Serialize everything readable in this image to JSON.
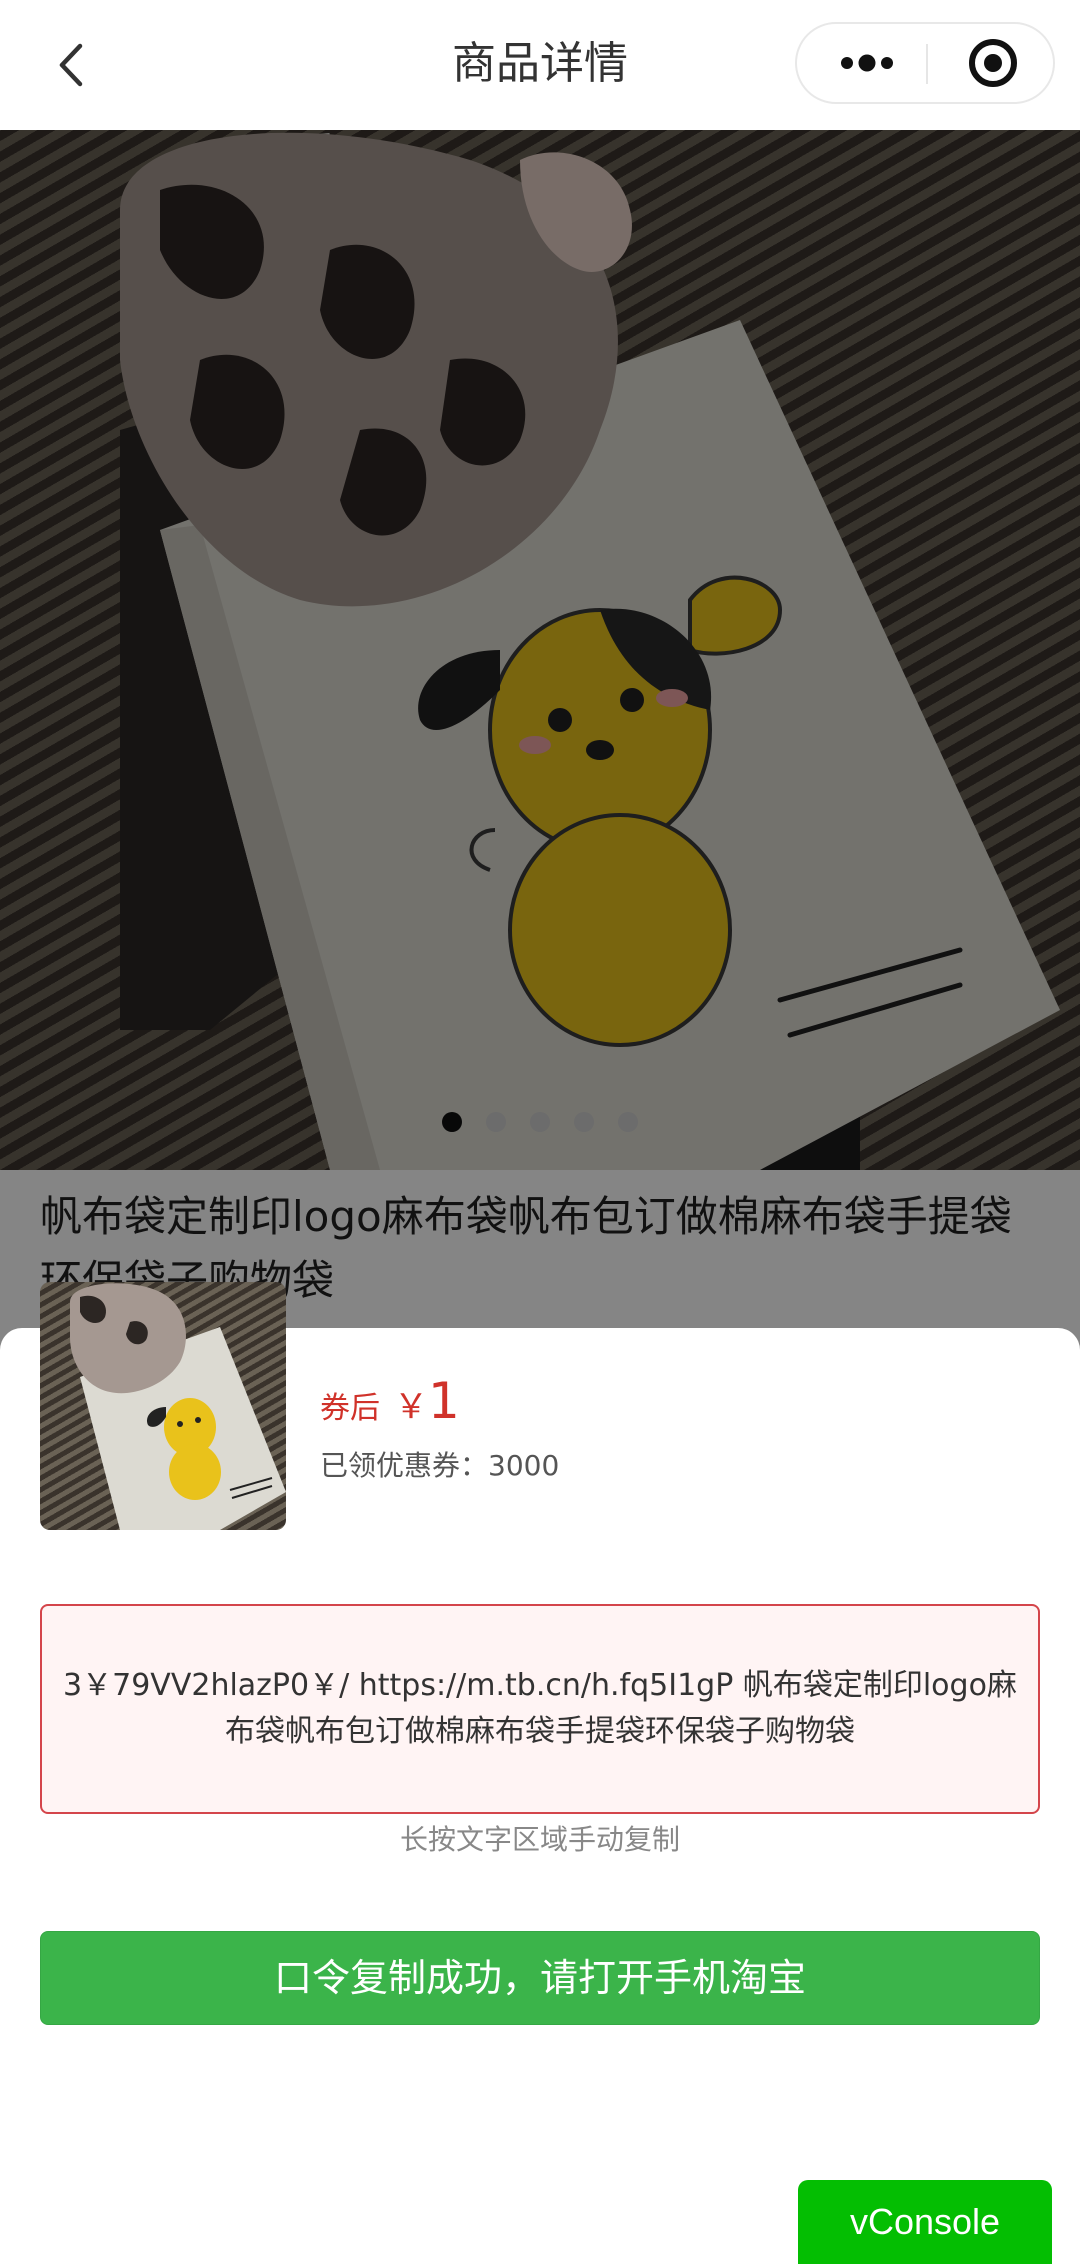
{
  "header": {
    "title": "商品详情",
    "back_icon": "chevron-left-icon",
    "more_icon": "more-dots-icon",
    "target_icon": "target-icon"
  },
  "hero": {
    "image_count": 5,
    "active_index": 0
  },
  "product": {
    "title": "帆布袋定制印logo麻布袋帆布包订做棉麻布袋手提袋环保袋子购物袋"
  },
  "sheet": {
    "price_prefix": "券后",
    "currency": "￥",
    "price": "1",
    "coupon_text": "已领优惠券：3000",
    "code_text": "3￥79VV2hlazP0￥/ https://m.tb.cn/h.fq5I1gP 帆布袋定制印logo麻布袋帆布包订做棉麻布袋手提袋环保袋子购物袋",
    "hint": "长按文字区域手动复制",
    "button_label": "口令复制成功，请打开手机淘宝"
  },
  "vconsole": {
    "label": "vConsole"
  },
  "colors": {
    "price": "#d0322a",
    "button": "#3bb44a",
    "vconsole": "#04be02",
    "code_border": "#d4454b"
  }
}
